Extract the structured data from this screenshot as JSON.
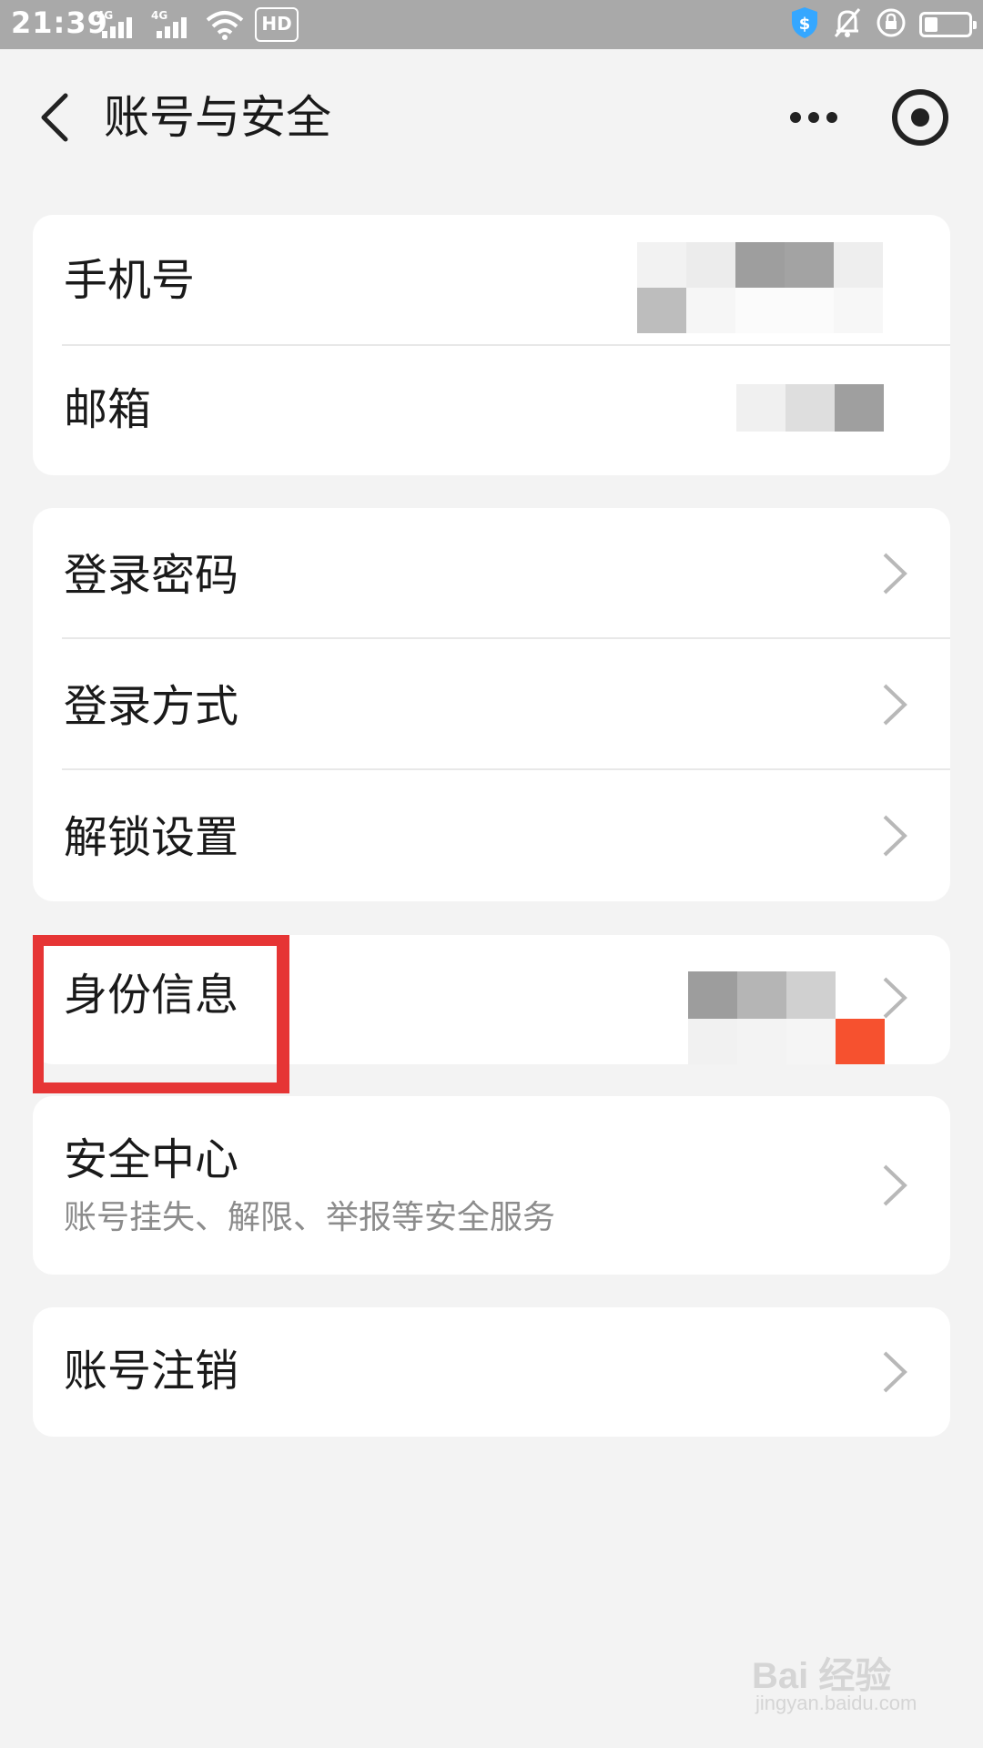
{
  "status_bar": {
    "time": "21:39",
    "network_1": "4G",
    "network_2": "4G",
    "hd_label": "HD",
    "battery_level": 0.3,
    "icons": [
      "signal-icon",
      "signal-icon",
      "wifi-icon",
      "hd-icon",
      "shield-icon",
      "bell-off-icon",
      "rotation-lock-icon",
      "battery-icon"
    ]
  },
  "nav": {
    "title": "账号与安全",
    "icons": [
      "back-arrow-icon",
      "more-icon",
      "record-icon"
    ]
  },
  "cards": {
    "contact": {
      "phone_label": "手机号",
      "email_label": "邮箱"
    },
    "login": {
      "password_label": "登录密码",
      "method_label": "登录方式",
      "unlock_label": "解锁设置"
    },
    "identity": {
      "label": "身份信息"
    },
    "security_center": {
      "label": "安全中心",
      "subtitle": "账号挂失、解限、举报等安全服务"
    },
    "cancel": {
      "label": "账号注销"
    }
  },
  "colors": {
    "background": "#f3f3f3",
    "status_bar": "#a9a9a9",
    "card": "#ffffff",
    "highlight_box": "#e63535",
    "shield": "#35a7ff",
    "chevron": "#b8b8b8"
  },
  "watermark": {
    "logo": "Bai 经验",
    "url": "jingyan.baidu.com"
  }
}
